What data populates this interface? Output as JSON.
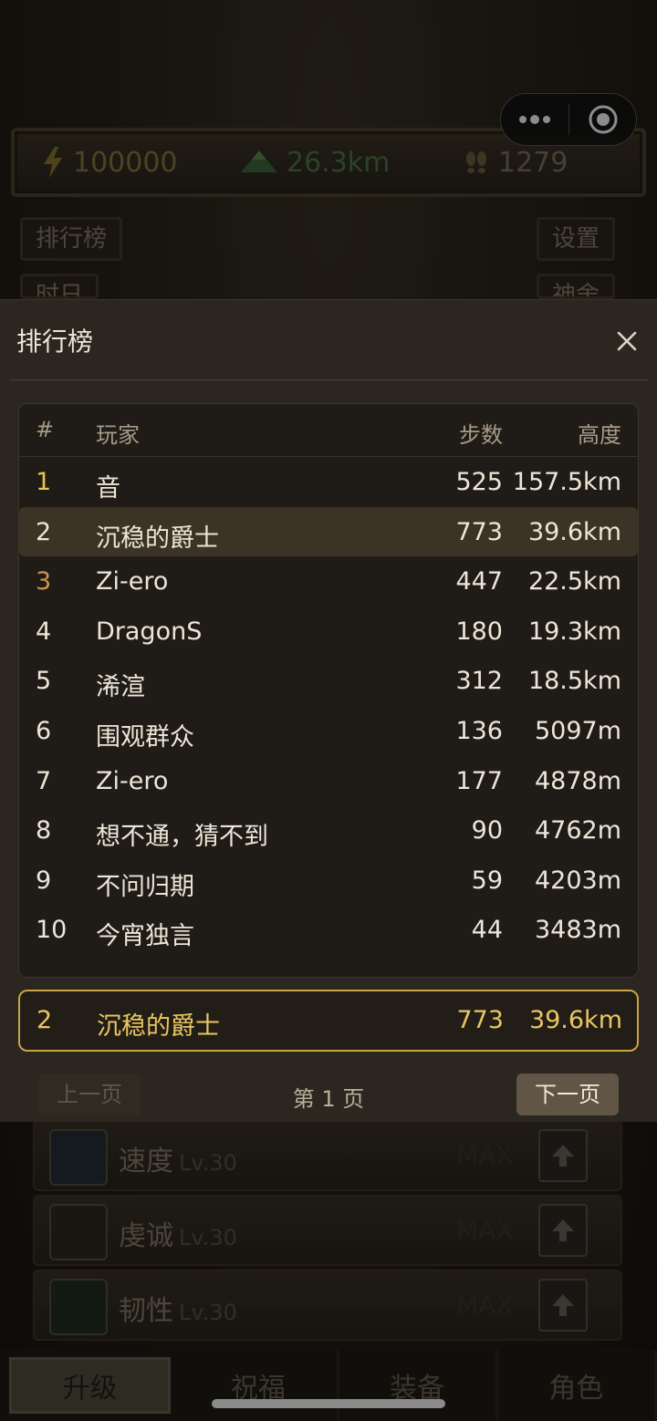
{
  "status": {
    "energy": "100000",
    "height": "26.3km",
    "steps": "1279"
  },
  "side_buttons": {
    "leaderboard": "排行榜",
    "settings": "设置",
    "left_partial": "时日",
    "right_partial": "神舍"
  },
  "skills": [
    {
      "name": "速度",
      "level": "Lv.30",
      "max": "MAX"
    },
    {
      "name": "虔诚",
      "level": "Lv.30",
      "max": "MAX"
    },
    {
      "name": "韧性",
      "level": "Lv.30",
      "max": "MAX"
    }
  ],
  "bottom_tabs": [
    "升级",
    "祝福",
    "装备",
    "角色"
  ],
  "modal": {
    "title": "排行榜",
    "columns": {
      "rank": "#",
      "player": "玩家",
      "steps": "步数",
      "height": "高度"
    },
    "rows": [
      {
        "rank": "1",
        "player": "音",
        "steps": "525",
        "height": "157.5km"
      },
      {
        "rank": "2",
        "player": "沉稳的爵士",
        "steps": "773",
        "height": "39.6km"
      },
      {
        "rank": "3",
        "player": "Zi-ero",
        "steps": "447",
        "height": "22.5km"
      },
      {
        "rank": "4",
        "player": "DragonS",
        "steps": "180",
        "height": "19.3km"
      },
      {
        "rank": "5",
        "player": "浠渲",
        "steps": "312",
        "height": "18.5km"
      },
      {
        "rank": "6",
        "player": "围观群众",
        "steps": "136",
        "height": "5097m"
      },
      {
        "rank": "7",
        "player": "Zi-ero",
        "steps": "177",
        "height": "4878m"
      },
      {
        "rank": "8",
        "player": "想不通，猜不到",
        "steps": "90",
        "height": "4762m"
      },
      {
        "rank": "9",
        "player": "不问归期",
        "steps": "59",
        "height": "4203m"
      },
      {
        "rank": "10",
        "player": "今宵独言",
        "steps": "44",
        "height": "3483m"
      }
    ],
    "self": {
      "rank": "2",
      "player": "沉稳的爵士",
      "steps": "773",
      "height": "39.6km"
    },
    "pager": {
      "prev": "上一页",
      "info": "第 1 页",
      "next": "下一页"
    }
  },
  "colors": {
    "gold": "#e6c64b",
    "bronze": "#d29250",
    "highlight_border": "#c9a446"
  }
}
